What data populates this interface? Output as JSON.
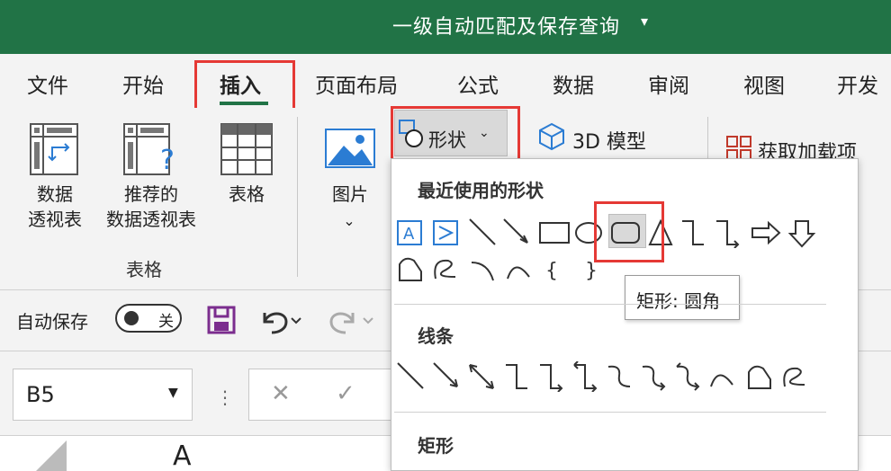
{
  "window": {
    "title": "一级自动匹配及保存查询",
    "title_caret": "▾"
  },
  "tabs": [
    {
      "label": "文件"
    },
    {
      "label": "开始"
    },
    {
      "label": "插入"
    },
    {
      "label": "页面布局"
    },
    {
      "label": "公式"
    },
    {
      "label": "数据"
    },
    {
      "label": "审阅"
    },
    {
      "label": "视图"
    },
    {
      "label": "开发工"
    }
  ],
  "ribbon": {
    "pivot_table": [
      "数据",
      "透视表"
    ],
    "recommended_pivot": [
      "推荐的",
      "数据透视表"
    ],
    "table": "表格",
    "group_tables": "表格",
    "pictures": "图片",
    "pictures_caret": "⌄",
    "shapes": "形状",
    "shapes_caret": "⌄",
    "model3d": "3D 模型",
    "addins": "获取加载项"
  },
  "qat": {
    "autosave": "自动保存",
    "toggle_state": "关"
  },
  "formula_bar": {
    "name_box": "B5",
    "cancel_icon": "✕",
    "confirm_icon": "✓"
  },
  "column_header": "A",
  "shapes_menu": {
    "recent_title": "最近使用的形状",
    "lines_title": "线条",
    "rect_title": "矩形",
    "tooltip": "矩形: 圆角"
  },
  "colors": {
    "titlebar": "#217346",
    "highlight": "#e53935"
  }
}
